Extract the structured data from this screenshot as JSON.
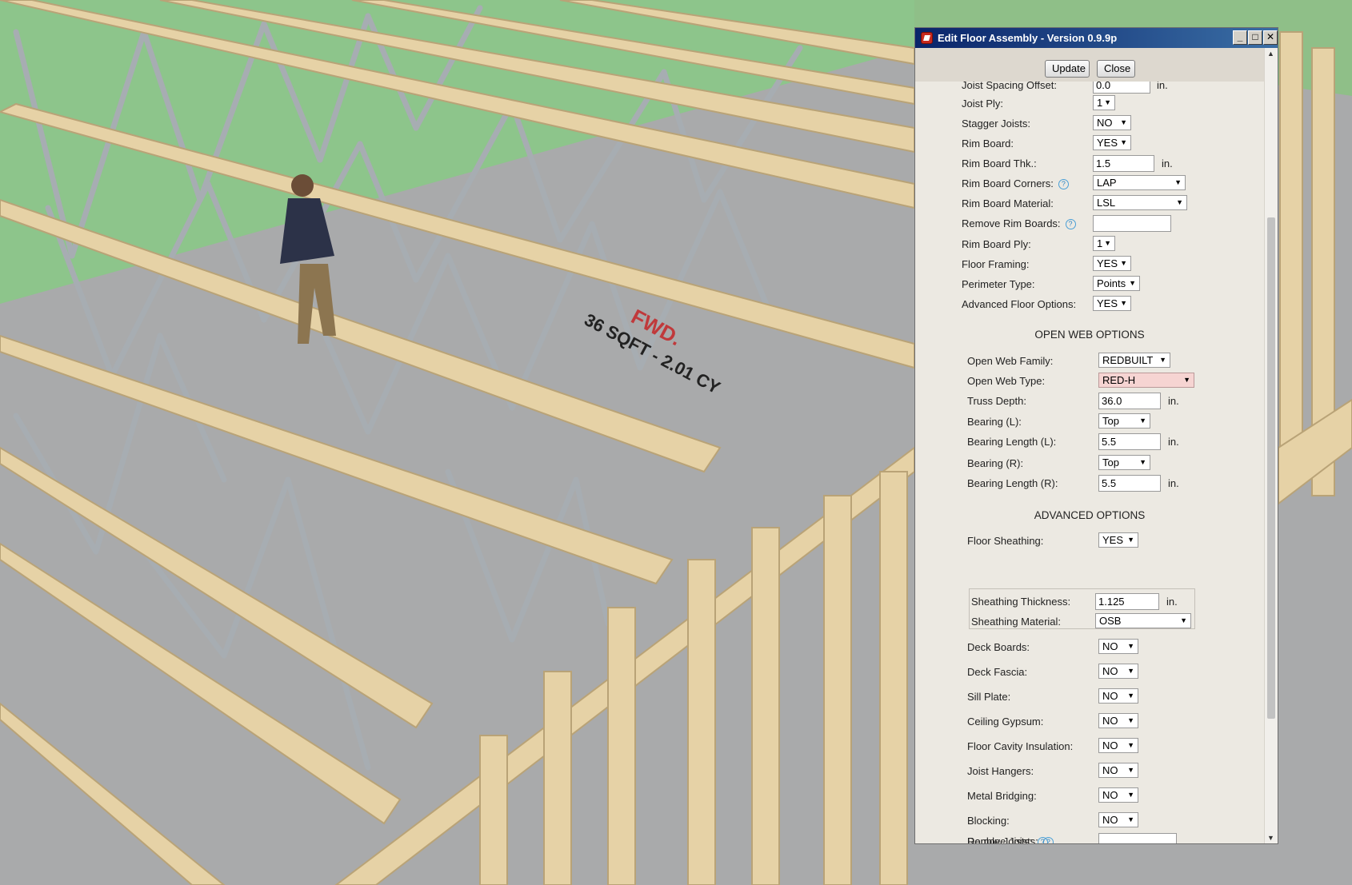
{
  "dialog": {
    "title": "Edit Floor Assembly - Version 0.9.9p",
    "update_label": "Update",
    "close_label": "Close",
    "minimize_glyph": "_",
    "maximize_glyph": "□",
    "close_glyph": "✕"
  },
  "help_glyph": "?",
  "dropdown_arrow": "▼",
  "scroll_up_glyph": "▲",
  "scroll_down_glyph": "▼",
  "fields": {
    "joist_spacing_offset": {
      "label": "Joist Spacing Offset:",
      "value": "0.0",
      "unit": "in."
    },
    "joist_ply": {
      "label": "Joist Ply:",
      "value": "1"
    },
    "stagger_joists": {
      "label": "Stagger Joists:",
      "value": "NO"
    },
    "rim_board": {
      "label": "Rim Board:",
      "value": "YES"
    },
    "rim_board_thk": {
      "label": "Rim Board Thk.:",
      "value": "1.5",
      "unit": "in."
    },
    "rim_board_corners": {
      "label": "Rim Board Corners:",
      "value": "LAP"
    },
    "rim_board_material": {
      "label": "Rim Board Material:",
      "value": "LSL"
    },
    "remove_rim_boards": {
      "label": "Remove Rim Boards:",
      "value": ""
    },
    "rim_board_ply": {
      "label": "Rim Board Ply:",
      "value": "1"
    },
    "floor_framing": {
      "label": "Floor Framing:",
      "value": "YES"
    },
    "perimeter_type": {
      "label": "Perimeter Type:",
      "value": "Points"
    },
    "advanced_floor_options": {
      "label": "Advanced Floor Options:",
      "value": "YES"
    }
  },
  "open_web": {
    "heading": "OPEN WEB OPTIONS",
    "family": {
      "label": "Open Web Family:",
      "value": "REDBUILT"
    },
    "type": {
      "label": "Open Web Type:",
      "value": "RED-H"
    },
    "truss_depth": {
      "label": "Truss Depth:",
      "value": "36.0",
      "unit": "in."
    },
    "bearing_l": {
      "label": "Bearing (L):",
      "value": "Top"
    },
    "bearing_length_l": {
      "label": "Bearing Length (L):",
      "value": "5.5",
      "unit": "in."
    },
    "bearing_r": {
      "label": "Bearing (R):",
      "value": "Top"
    },
    "bearing_length_r": {
      "label": "Bearing Length (R):",
      "value": "5.5",
      "unit": "in."
    }
  },
  "advanced": {
    "heading": "ADVANCED OPTIONS",
    "floor_sheathing": {
      "label": "Floor Sheathing:",
      "value": "YES"
    },
    "sheathing_thickness": {
      "label": "Sheathing Thickness:",
      "value": "1.125",
      "unit": "in."
    },
    "sheathing_material": {
      "label": "Sheathing Material:",
      "value": "OSB"
    },
    "deck_boards": {
      "label": "Deck Boards:",
      "value": "NO"
    },
    "deck_fascia": {
      "label": "Deck Fascia:",
      "value": "NO"
    },
    "sill_plate": {
      "label": "Sill Plate:",
      "value": "NO"
    },
    "ceiling_gypsum": {
      "label": "Ceiling Gypsum:",
      "value": "NO"
    },
    "floor_cavity_insulation": {
      "label": "Floor Cavity Insulation:",
      "value": "NO"
    },
    "joist_hangers": {
      "label": "Joist Hangers:",
      "value": "NO"
    },
    "metal_bridging": {
      "label": "Metal Bridging:",
      "value": "NO"
    },
    "blocking": {
      "label": "Blocking:",
      "value": "NO"
    },
    "remove_joists": {
      "label": "Remove Joists:",
      "value": ""
    },
    "double_joists": {
      "label": "Double Joists:",
      "value": ""
    }
  },
  "scene": {
    "floor_label": "FWD.",
    "floor_text": "36 SQFT - 2.01 CY",
    "colors": {
      "lumber": "#e6d2a6",
      "lumber_edge": "#b9a377",
      "steel_web": "#a7adb2",
      "slab": "#a9aaab",
      "ground": "#8fbf88",
      "wall_sheathing": "#8dc58b"
    }
  }
}
